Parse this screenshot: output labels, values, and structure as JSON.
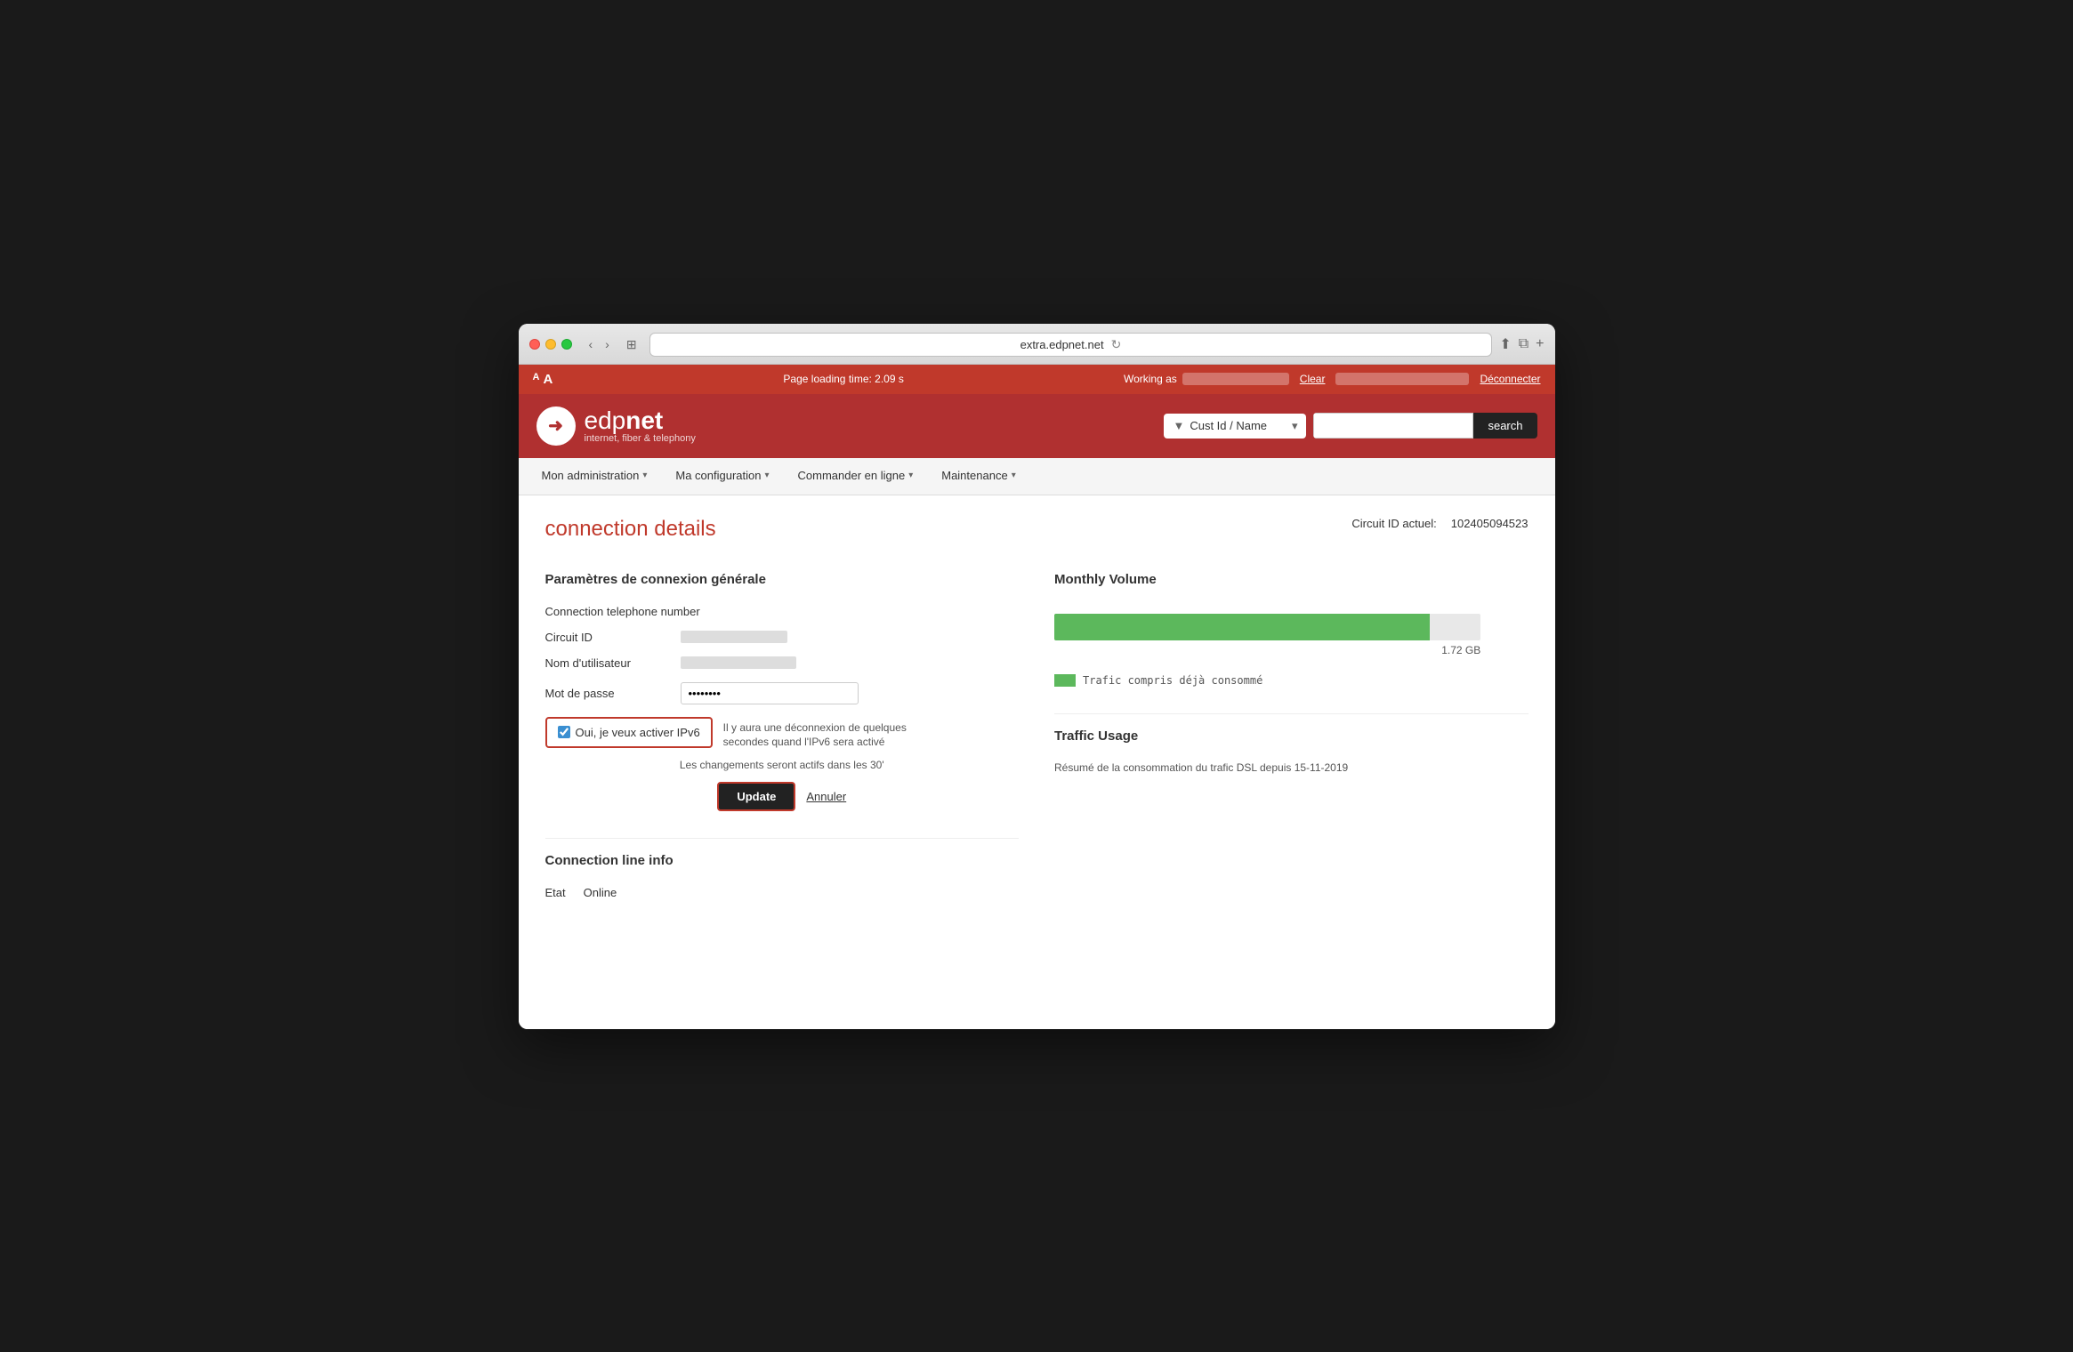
{
  "browser": {
    "url": "extra.edpnet.net",
    "back_label": "‹",
    "forward_label": "›",
    "sidebar_label": "⊞",
    "refresh_label": "↻",
    "share_label": "⬆",
    "newtab_label": "⧉",
    "plus_label": "+"
  },
  "admin_bar": {
    "font_small": "A",
    "font_large": "A",
    "page_load_label": "Page loading time: 2.09 s",
    "working_as_label": "Working as",
    "clear_label": "Clear",
    "deconnecter_label": "Déconnecter"
  },
  "header": {
    "logo_icon": "➜",
    "logo_edp": "edp",
    "logo_net": "net",
    "logo_subtitle": "internet, fiber & telephony",
    "filter_label": "Cust Id / Name",
    "search_placeholder": "",
    "search_label": "search"
  },
  "nav": {
    "items": [
      {
        "label": "Mon administration",
        "has_dropdown": true
      },
      {
        "label": "Ma configuration",
        "has_dropdown": true
      },
      {
        "label": "Commander en ligne",
        "has_dropdown": true
      },
      {
        "label": "Maintenance",
        "has_dropdown": true
      }
    ]
  },
  "main": {
    "page_title": "connection details",
    "circuit_id_label": "Circuit ID actuel:",
    "circuit_id_value": "102405094523",
    "left_section": {
      "title": "Paramètres de connexion générale",
      "fields": [
        {
          "label": "Connection telephone number",
          "value": "",
          "type": "text_blurred"
        },
        {
          "label": "Circuit ID",
          "value": "",
          "type": "blurred"
        },
        {
          "label": "Nom d'utilisateur",
          "value": "",
          "type": "blurred"
        },
        {
          "label": "Mot de passe",
          "value": "",
          "type": "input_blurred"
        }
      ],
      "ipv6_checkbox_label": "Oui, je veux activer IPv6",
      "ipv6_description": "Il y aura une déconnexion de quelques secondes quand l'IPv6 sera activé",
      "changes_note": "Les changements seront actifs dans les 30'",
      "update_label": "Update",
      "annuler_label": "Annuler"
    },
    "right_section": {
      "monthly_volume_title": "Monthly Volume",
      "volume_gb": "1.72 GB",
      "volume_percent": 88,
      "legend_label": "Trafic compris déjà consommé",
      "traffic_title": "Traffic Usage",
      "traffic_subtitle": "Résumé de la consommation du trafic DSL depuis 15-11-2019"
    },
    "connection_line": {
      "title": "Connection line info",
      "etat_label": "Etat",
      "etat_value": "Online"
    }
  }
}
